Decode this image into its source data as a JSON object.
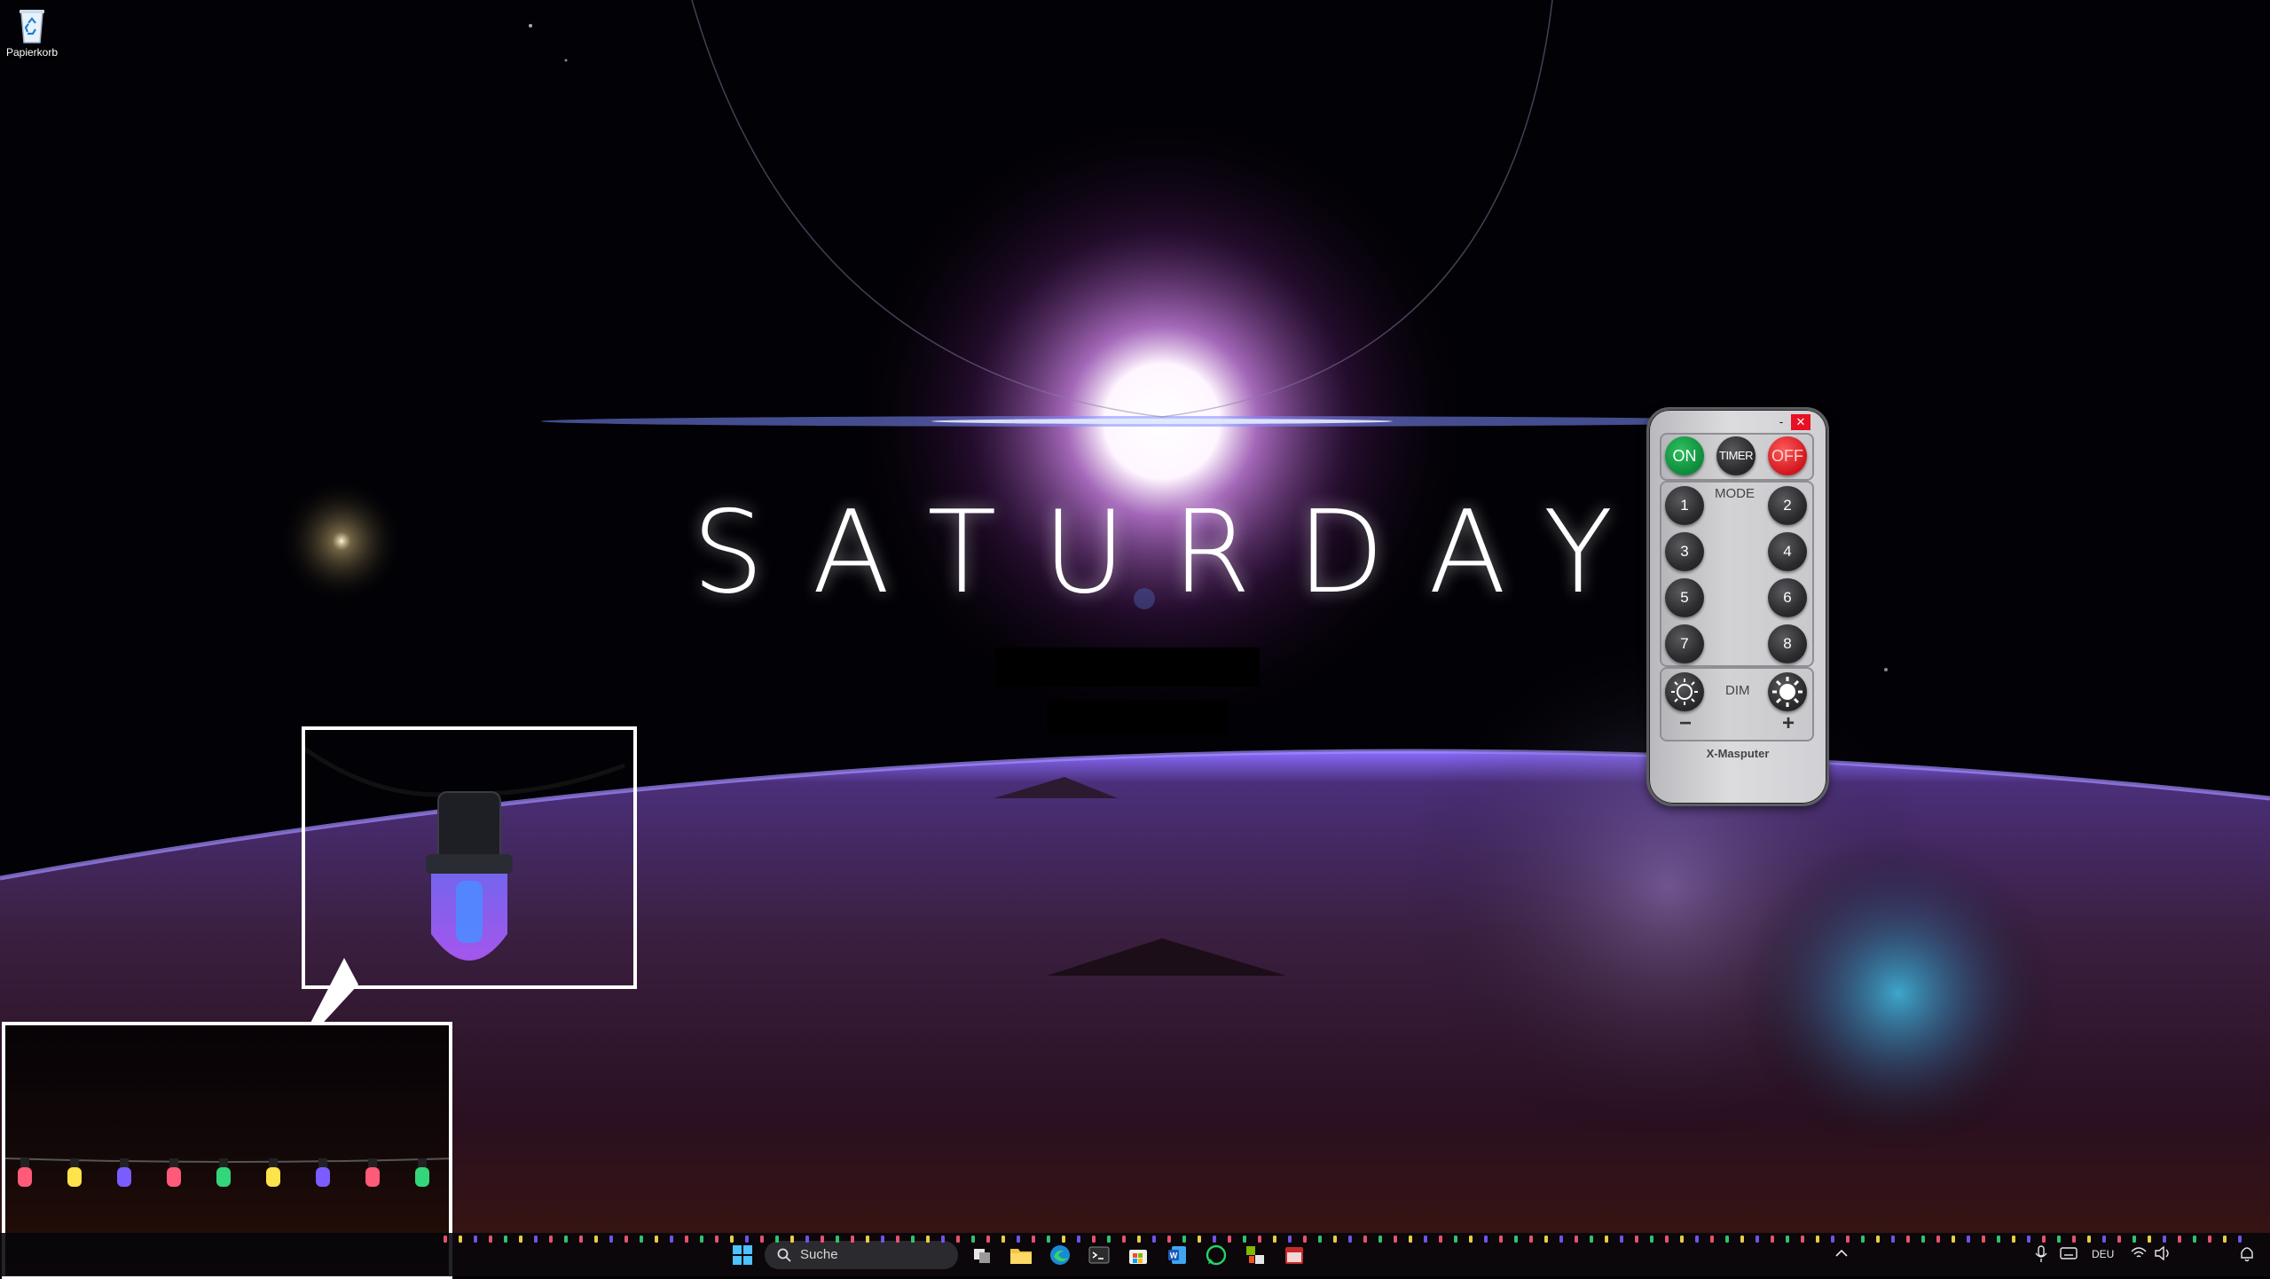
{
  "desktop": {
    "recycle_bin_label": "Papierkorb"
  },
  "wallpaper": {
    "headline": "SATURDAY"
  },
  "remote": {
    "minimize_symbol": "-",
    "close_symbol": "✕",
    "on_label": "ON",
    "timer_label": "TIMER",
    "off_label": "OFF",
    "mode_label": "MODE",
    "mode_buttons": [
      "1",
      "2",
      "3",
      "4",
      "5",
      "6",
      "7",
      "8"
    ],
    "dim_label": "DIM",
    "minus_label": "−",
    "plus_label": "+",
    "brand": "X-Masputer",
    "colors": {
      "on": "#0d8a3a",
      "off": "#d0161c",
      "body": "#d0d0d4"
    }
  },
  "light_colors": [
    "#ff5a78",
    "#ffe34a",
    "#7a5cff",
    "#ff5a78",
    "#34d67a",
    "#ffe34a",
    "#7a5cff",
    "#ff5a78",
    "#34d67a"
  ],
  "taskbar": {
    "search_placeholder": "Suche",
    "apps": [
      "start-icon",
      "search-icon",
      "task-view-icon",
      "file-explorer-icon",
      "edge-icon",
      "terminal-icon",
      "store-icon",
      "word-icon",
      "whatsapp-icon",
      "app-icon",
      "calendar-icon"
    ],
    "tray": {
      "language": "DEU",
      "icons": [
        "chevron-up-icon",
        "microphone-icon",
        "keyboard-icon",
        "wifi-icon",
        "volume-icon",
        "notification-icon"
      ]
    }
  }
}
